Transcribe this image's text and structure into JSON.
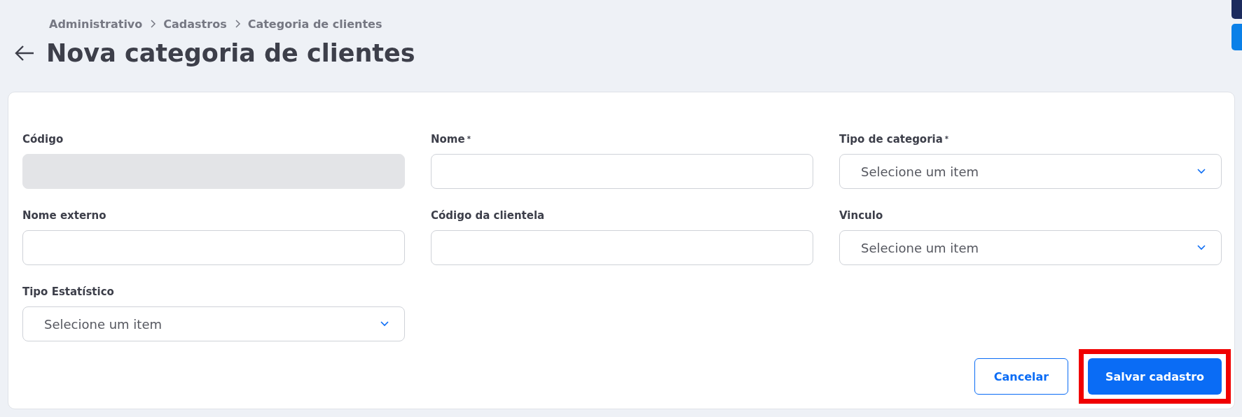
{
  "breadcrumb": [
    "Administrativo",
    "Cadastros",
    "Categoria de clientes"
  ],
  "title": "Nova categoria de clientes",
  "form": {
    "fields": [
      {
        "label": "Código",
        "kind": "text",
        "disabled": true
      },
      {
        "label": "Nome",
        "kind": "text",
        "required_mark": "*",
        "disabled": false
      },
      {
        "label": "Tipo de categoria",
        "kind": "select",
        "required_mark": "*",
        "placeholder": "Selecione um item"
      },
      {
        "label": "Nome externo",
        "kind": "text",
        "disabled": false
      },
      {
        "label": "Código da clientela",
        "kind": "text",
        "disabled": false
      },
      {
        "label": "Vinculo",
        "kind": "select",
        "placeholder": "Selecione um item"
      },
      {
        "label": "Tipo Estatístico",
        "kind": "select",
        "placeholder": "Selecione um item"
      }
    ],
    "buttons": [
      {
        "label": "Cancelar",
        "kind": "secondary",
        "highlighted": false
      },
      {
        "label": "Salvar cadastro",
        "kind": "primary",
        "highlighted": true
      }
    ]
  }
}
